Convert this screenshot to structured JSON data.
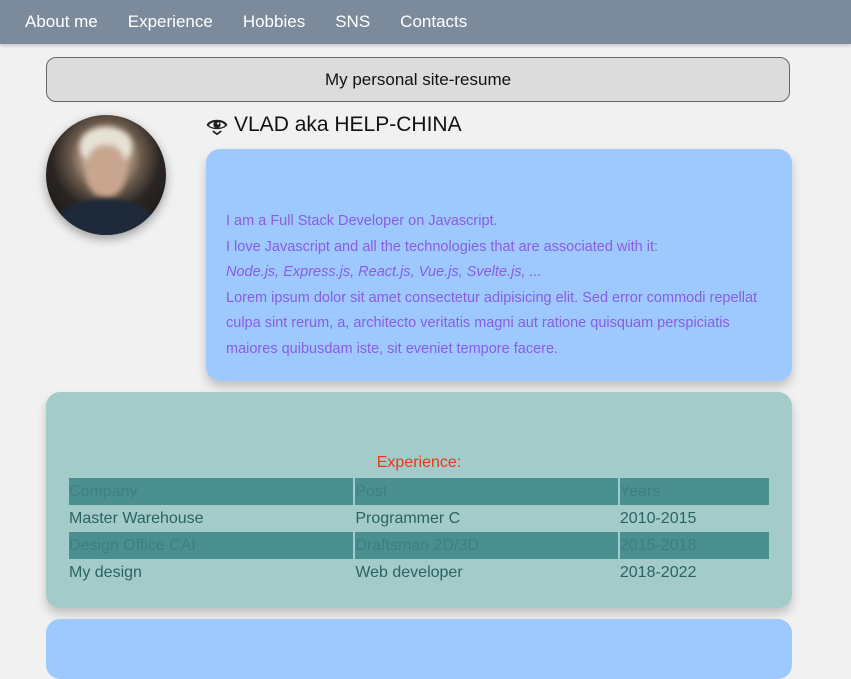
{
  "nav": {
    "items": [
      {
        "label": "About me"
      },
      {
        "label": "Experience"
      },
      {
        "label": "Hobbies"
      },
      {
        "label": "SNS"
      },
      {
        "label": "Contacts"
      }
    ]
  },
  "header": {
    "title": "My personal site-resume"
  },
  "profile": {
    "name": "VLAD aka HELP-CHINA",
    "name_icon": "eye-icon"
  },
  "about": {
    "line1": "I am a Full Stack Developer on Javascript.",
    "line2": "I love Javascript and all the technologies that are associated with it:",
    "techs": "Node.js, Express.js, React.js, Vue.js, Svelte.js, ...",
    "lorem": "Lorem ipsum dolor sit amet consectetur adipisicing elit. Sed error commodi repellat culpa sint rerum, a, architecto veritatis magni aut ratione quisquam perspiciatis maiores quibusdam iste, sit eveniet tempore facere."
  },
  "experience": {
    "title": "Experience:",
    "headers": [
      "Company",
      "Post",
      "Years"
    ],
    "rows": [
      [
        "Master Warehouse",
        "Programmer C",
        "2010-2015"
      ],
      [
        "Design Office CAI",
        "Draftsman 2D/3D",
        "2015-2018"
      ],
      [
        "My design",
        "Web developer",
        "2018-2022"
      ]
    ]
  },
  "colors": {
    "nav_bg": "#7b8b9c",
    "about_bg": "#9ec9ff",
    "about_text": "#8a5de0",
    "exp_bg": "#a3cbc9",
    "exp_title": "#e8391d",
    "exp_row_dark": "#4a9090"
  }
}
